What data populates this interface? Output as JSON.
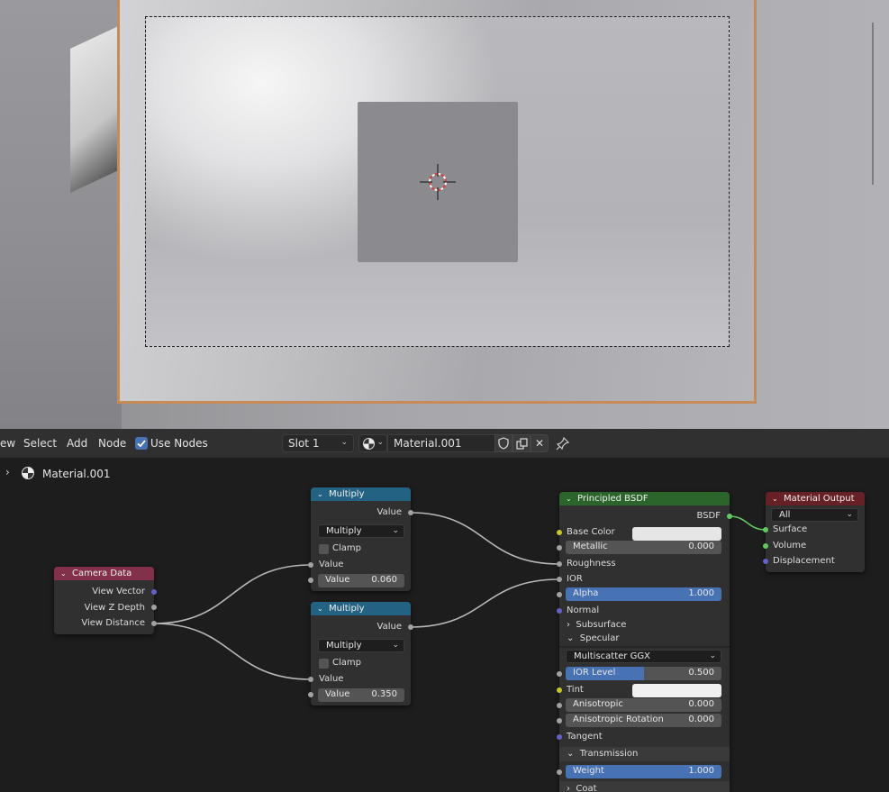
{
  "viewport": {
    "description": ""
  },
  "header": {
    "menu": [
      "ew",
      "Select",
      "Add",
      "Node"
    ],
    "use_nodes_label": "Use Nodes",
    "slot": "Slot 1",
    "material_name": "Material.001"
  },
  "breadcrumb": {
    "label": "Material.001"
  },
  "nodes": {
    "camera_data": {
      "title": "Camera Data",
      "outputs": [
        "View Vector",
        "View Z Depth",
        "View Distance"
      ]
    },
    "multiply1": {
      "title": "Multiply",
      "output": "Value",
      "operation": "Multiply",
      "clamp_label": "Clamp",
      "input_label": "Value",
      "value_label": "Value",
      "value": "0.060"
    },
    "multiply2": {
      "title": "Multiply",
      "output": "Value",
      "operation": "Multiply",
      "clamp_label": "Clamp",
      "input_label": "Value",
      "value_label": "Value",
      "value": "0.350"
    },
    "bsdf": {
      "title": "Principled BSDF",
      "output": "BSDF",
      "base_color": "Base Color",
      "metallic_label": "Metallic",
      "metallic": "0.000",
      "roughness": "Roughness",
      "ior": "IOR",
      "alpha_label": "Alpha",
      "alpha": "1.000",
      "normal": "Normal",
      "subsurface": "Subsurface",
      "specular": "Specular",
      "distribution": "Multiscatter GGX",
      "ior_level_label": "IOR Level",
      "ior_level": "0.500",
      "ior_level_fraction": 0.5,
      "tint": "Tint",
      "anisotropic_label": "Anisotropic",
      "anisotropic": "0.000",
      "aniso_rot_label": "Anisotropic Rotation",
      "aniso_rot": "0.000",
      "tangent": "Tangent",
      "transmission": "Transmission",
      "weight_label": "Weight",
      "weight": "1.000",
      "coat": "Coat"
    },
    "output": {
      "title": "Material Output",
      "target": "All",
      "inputs": [
        "Surface",
        "Volume",
        "Displacement"
      ]
    }
  },
  "colors": {
    "accent": "#4772b3",
    "camera_header": "#83314a",
    "math_header": "#246283",
    "shader_header": "#2b652b",
    "output_header": "#662026",
    "camera_frame": "#c78b58"
  }
}
